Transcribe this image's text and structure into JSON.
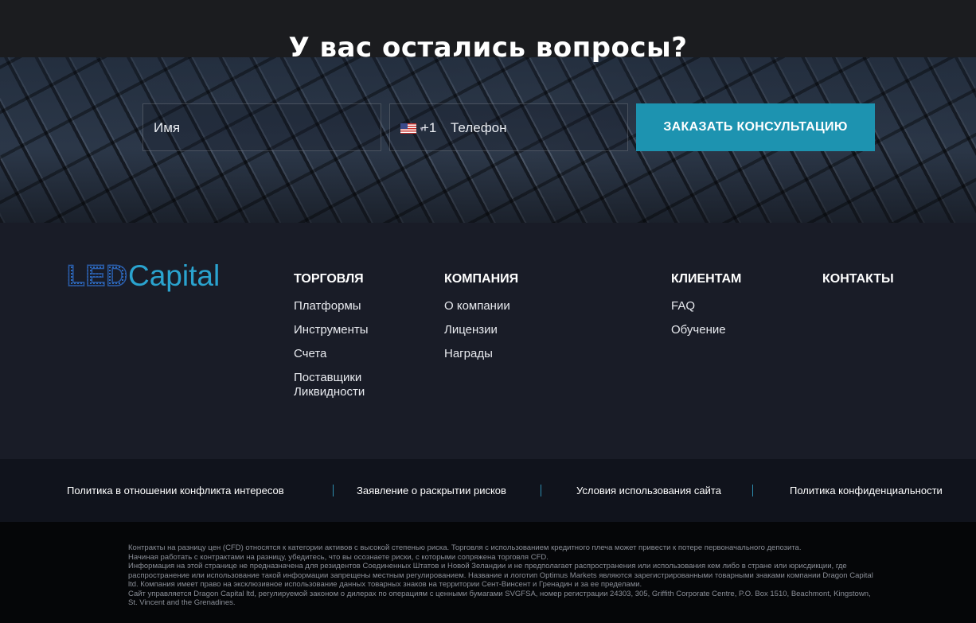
{
  "hero": {
    "title": "У вас остались вопросы?",
    "name_placeholder": "Имя",
    "phone_code": "+1",
    "phone_placeholder": "Телефон",
    "submit_label": "ЗАКАЗАТЬ КОНСУЛЬТАЦИЮ"
  },
  "footer": {
    "logo": {
      "part1": "LED",
      "part2": "Capital"
    },
    "columns": [
      {
        "title": "ТОРГОВЛЯ",
        "links": [
          "Платформы",
          "Инструменты",
          "Счета",
          "Поставщики Ликвидности"
        ]
      },
      {
        "title": "КОМПАНИЯ",
        "links": [
          "О компании",
          "Лицензии",
          "Награды"
        ]
      },
      {
        "title": "КЛИЕНТАМ",
        "links": [
          "FAQ",
          "Обучение"
        ]
      },
      {
        "title": "КОНТАКТЫ",
        "links": []
      }
    ]
  },
  "policies": [
    "Политика в отношении конфликта интересов",
    "Заявление о раскрытии рисков",
    "Условия использования сайта",
    "Политика конфиденциальности"
  ],
  "disclaimer": [
    "Контракты на разницу цен (CFD) относятся к категории активов с высокой степенью риска. Торговля с использованием кредитного плеча может привести к потере первоначального депозита.",
    "Начиная работать с контрактами на разницу, убедитесь, что вы осознаете риски, с которыми сопряжена торговля CFD.",
    "Информация на этой странице не предназначена для резидентов Соединенных Штатов и Новой Зеландии и не предполагает распространения или использования кем либо в стране или юрисдикции, где распространение или использование такой информации запрещены местным регулированием. Название и логотип Optimus Markets являются зарегистрированными товарными знаками компании Dragon Capital ltd. Компания имеет право на эксклюзивное использование данных товарных знаков на территории Сент-Винсент и Гренадин и за ее пределами.",
    "Сайт управляется Dragon Capital ltd, регулируемой законом о дилерах по операциям с ценными бумагами SVGFSA, номер регистрации 24303, 305, Griffith Corporate Centre, P.O. Box 1510, Beachmont, Kingstown, St. Vincent and the Grenadines."
  ],
  "colors": {
    "accent": "#1d93b0",
    "footer_bg": "#191c27",
    "logo_blue": "#2aa3cf"
  }
}
